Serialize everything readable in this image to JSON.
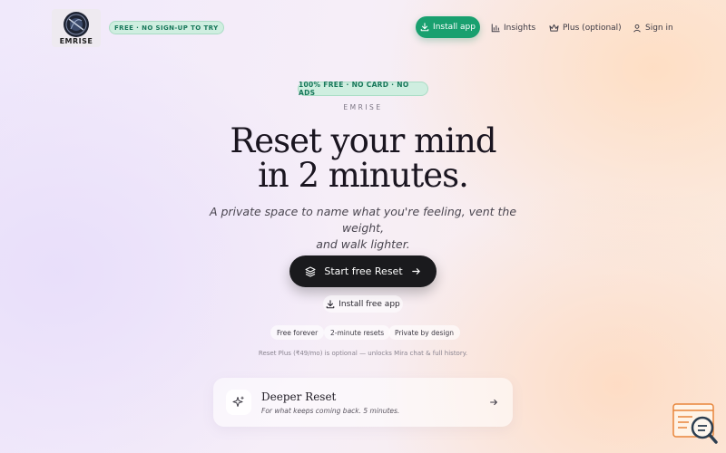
{
  "header": {
    "logo_text": "EMRISE",
    "tag": "FREE · NO SIGN-UP TO TRY",
    "install_label": "Install app",
    "nav": [
      {
        "label": "Insights",
        "icon": "bar-chart-icon"
      },
      {
        "label": "Plus (optional)",
        "icon": "crown-icon"
      },
      {
        "label": "Sign in",
        "icon": "user-icon"
      }
    ]
  },
  "hero": {
    "badge": "100% FREE · NO CARD · NO ADS",
    "eyebrow": "EMRISE",
    "headline_line1": "Reset your mind",
    "headline_line2": "in 2 minutes.",
    "subtitle_line1": "A private space to name what you're feeling, vent the weight,",
    "subtitle_line2": "and walk lighter.",
    "cta_label": "Start free Reset",
    "install_free_label": "Install free app",
    "chips": [
      "Free forever",
      "2-minute resets",
      "Private by design"
    ],
    "note": "Reset Plus (₹49/mo) is optional — unlocks Mira chat & full history."
  },
  "card": {
    "title": "Deeper Reset",
    "subtitle": "For what keeps coming back. 5 minutes.",
    "icon": "sparkles-icon"
  },
  "colors": {
    "accent_green": "#19a06f",
    "badge_bg": "#cfeee0",
    "badge_text": "#17775a",
    "cta_bg": "#1a1a1d",
    "widget_orange": "#e8853a"
  }
}
